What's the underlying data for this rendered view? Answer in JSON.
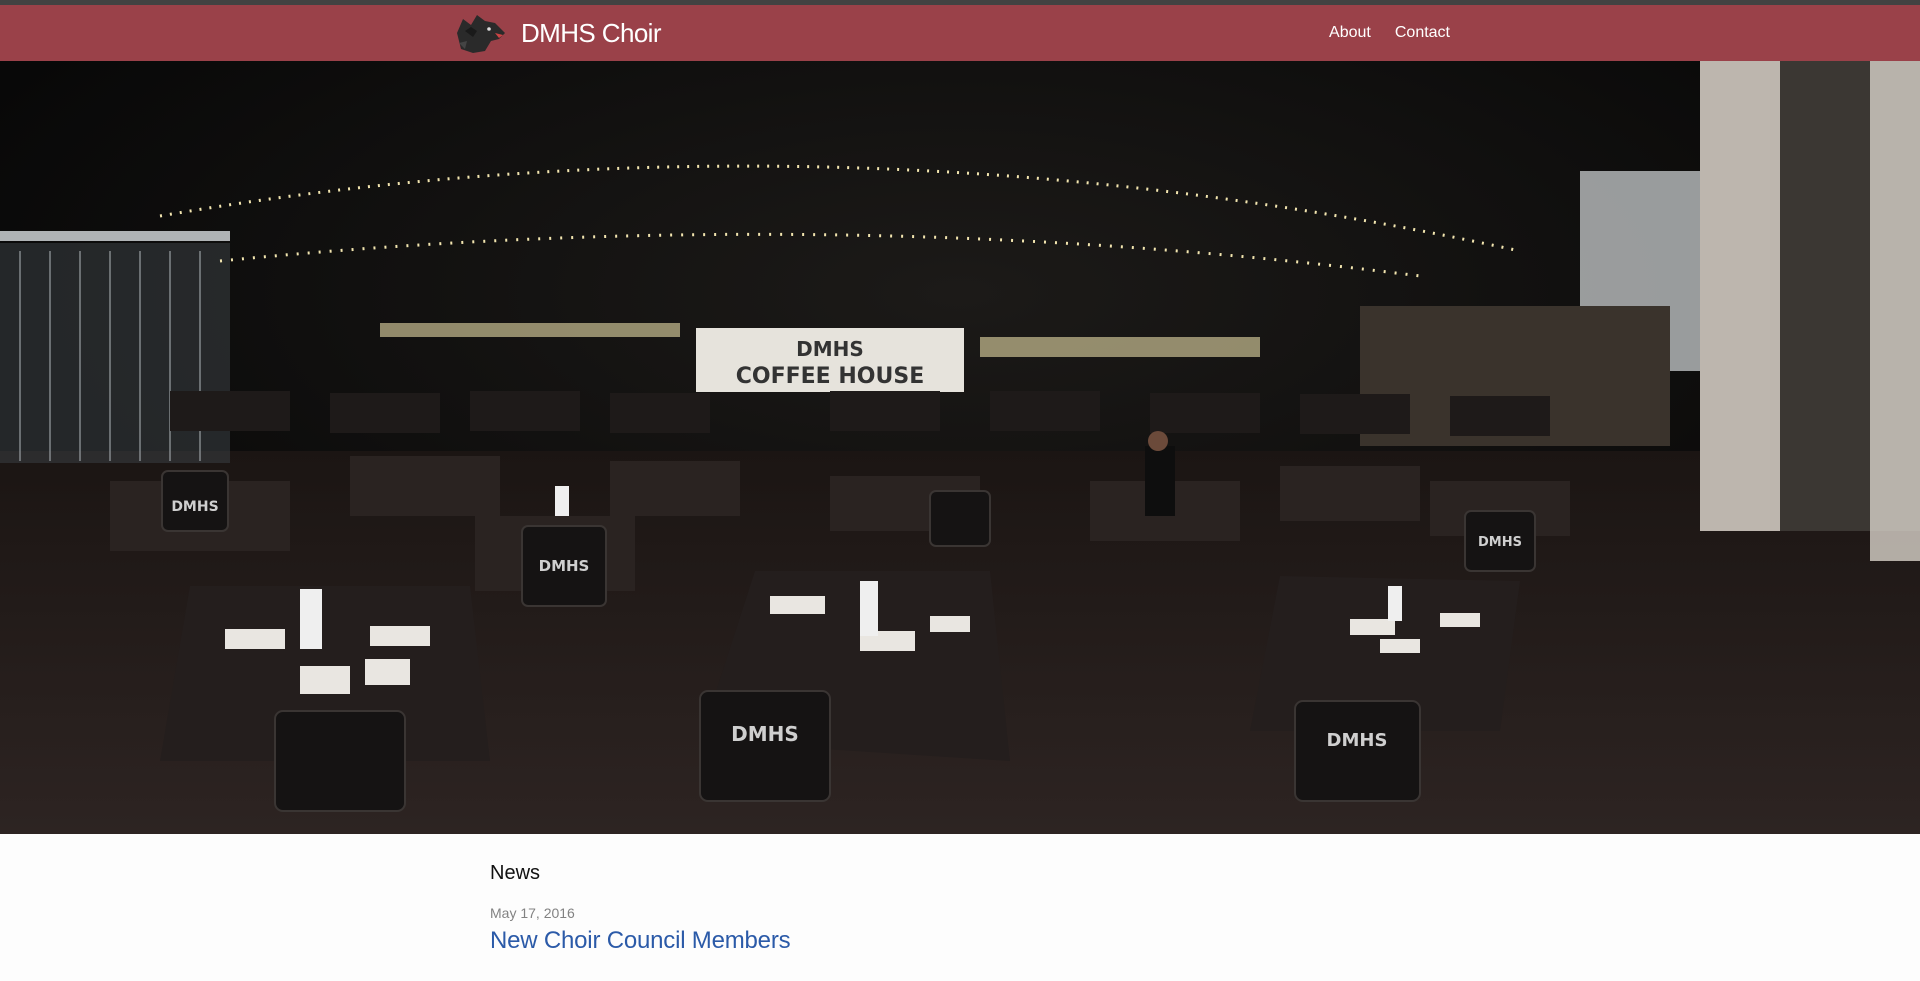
{
  "header": {
    "site_title": "DMHS Choir",
    "nav": [
      {
        "label": "About"
      },
      {
        "label": "Contact"
      }
    ],
    "logo_icon": "wolf-head-logo-icon"
  },
  "hero": {
    "image": "panoramic-photo-coffee-house-stage",
    "banner_line1": "DMHS",
    "banner_line2": "COFFEE HOUSE",
    "chair_print": "DMHS"
  },
  "main": {
    "section_title": "News",
    "posts": [
      {
        "date": "May 17, 2016",
        "title": "New Choir Council Members"
      }
    ]
  },
  "colors": {
    "header_bg": "#9a4149",
    "top_strip": "#424242",
    "link": "#2b5aa8",
    "date": "#828282"
  }
}
